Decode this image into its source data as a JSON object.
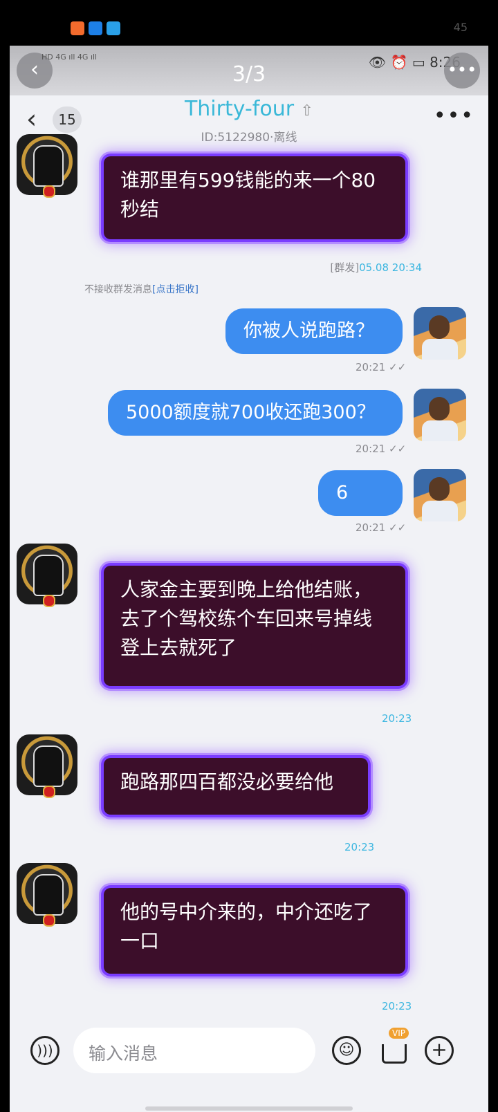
{
  "outer_status": {
    "time": "45"
  },
  "viewer": {
    "page_indicator": "3/3"
  },
  "inner_status": {
    "signal_left": "HD 4G ıll 4G ıll",
    "time": "8:26"
  },
  "header": {
    "back_count": "15",
    "title": "Thirty-four",
    "subtitle": "ID:5122980·离线"
  },
  "messages": [
    {
      "text": "谁那里有599钱能的来一个80秒结",
      "time_prefix": "[群发]",
      "time": "05.08 20:34"
    },
    {
      "notice_text": "不接收群发消息",
      "notice_link": "[点击拒收]"
    },
    {
      "text": "你被人说跑路？",
      "time": "20:21"
    },
    {
      "text": "5000额度就700收还跑300？",
      "time": "20:21"
    },
    {
      "text": "6",
      "time": "20:21"
    },
    {
      "text": "人家金主要到晚上给他结账，去了个驾校练个车回来号掉线登上去就死了",
      "time": "20:23"
    },
    {
      "text": "跑路那四百都没必要给他",
      "time": "20:23"
    },
    {
      "text": "他的号中介来的，中介还吃了一口",
      "time": "20:23"
    }
  ],
  "input": {
    "placeholder": "输入消息",
    "vip_label": "VIP"
  }
}
